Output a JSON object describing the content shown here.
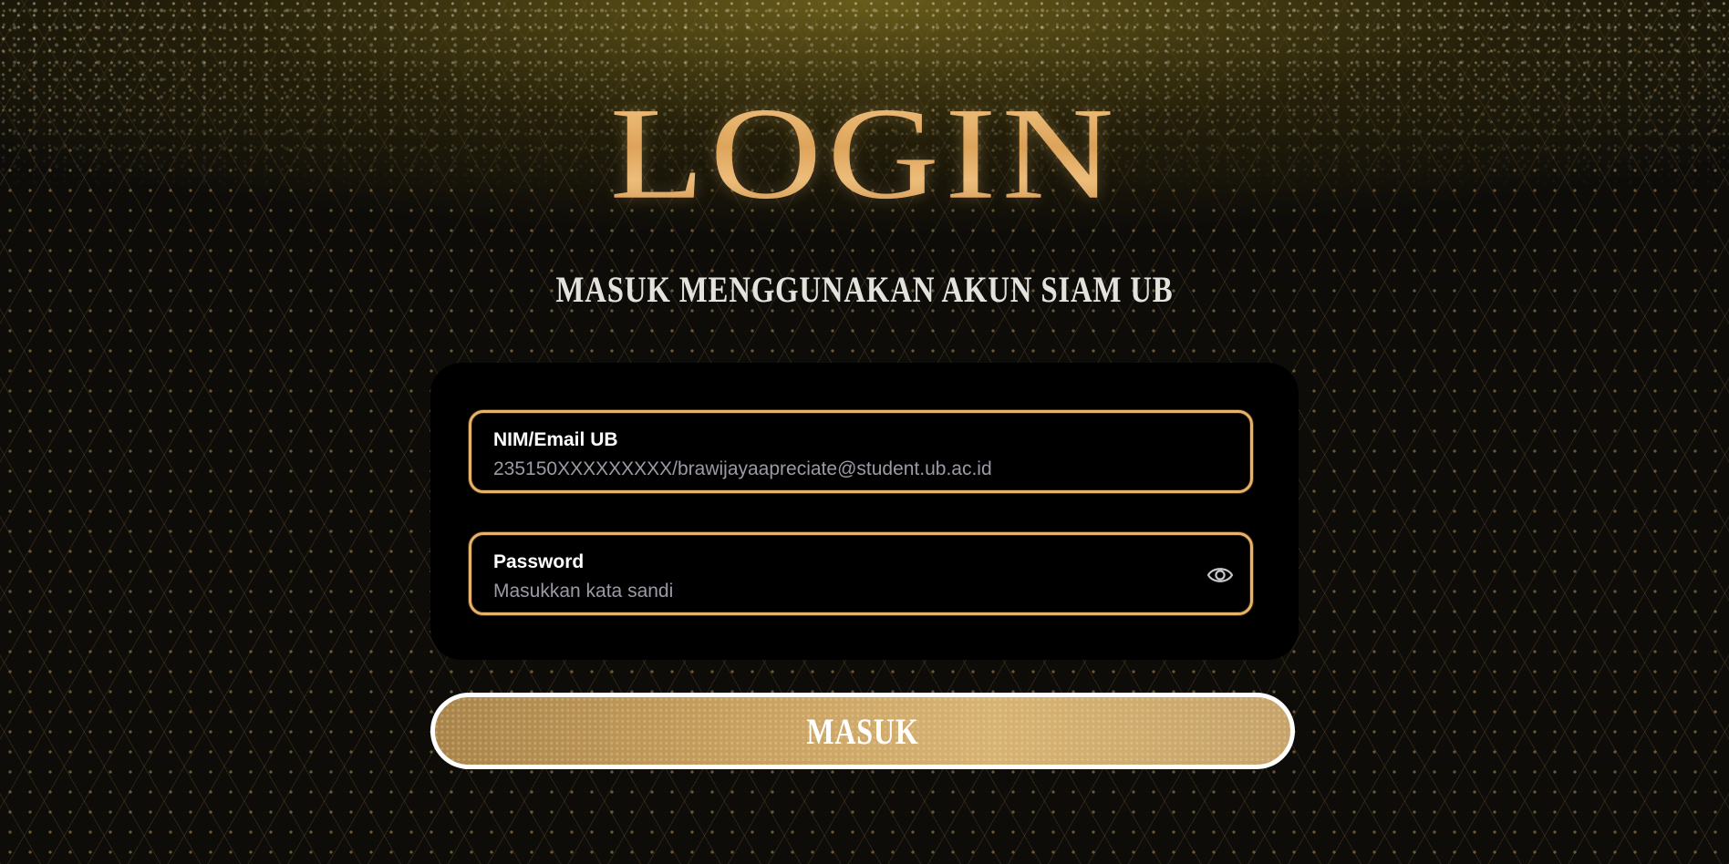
{
  "header": {
    "title": "LOGIN",
    "subtitle": "MASUK MENGGUNAKAN AKUN SIAM UB"
  },
  "form": {
    "email": {
      "label": "NIM/Email UB",
      "value": "",
      "placeholder": "235150XXXXXXXXX/brawijayaapreciate@student.ub.ac.id"
    },
    "password": {
      "label": "Password",
      "value": "",
      "placeholder": "Masukkan kata sandi",
      "toggle_icon": "eye-icon"
    },
    "submit_label": "MASUK"
  },
  "colors": {
    "gold": "#e7b36a",
    "card_background": "#000000",
    "page_background": "#0d0c09",
    "text": "#ffffff",
    "placeholder": "#9b9aa5"
  }
}
